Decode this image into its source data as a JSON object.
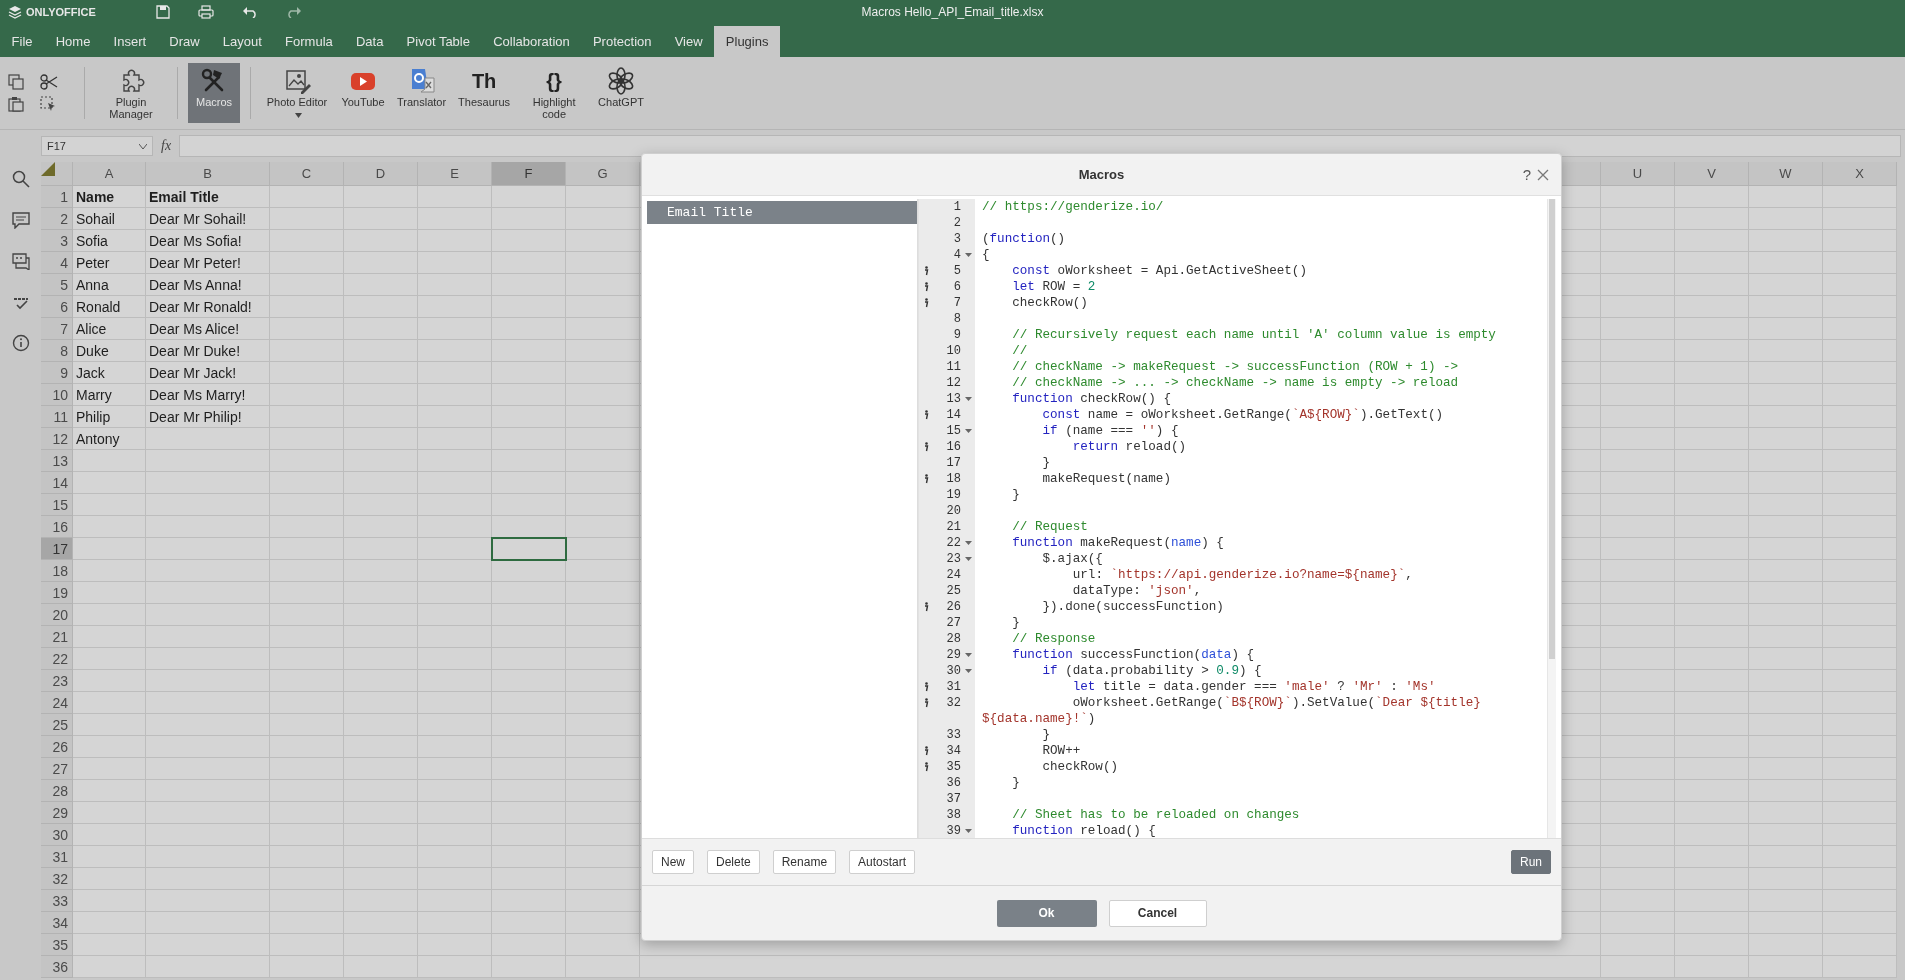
{
  "title_bar": {
    "logo": "ONLYOFFICE",
    "title": "Macros Hello_API_Email_title.xlsx"
  },
  "tabs": [
    {
      "label": "File",
      "selected": false
    },
    {
      "label": "Home",
      "selected": false
    },
    {
      "label": "Insert",
      "selected": false
    },
    {
      "label": "Draw",
      "selected": false
    },
    {
      "label": "Layout",
      "selected": false
    },
    {
      "label": "Formula",
      "selected": false
    },
    {
      "label": "Data",
      "selected": false
    },
    {
      "label": "Pivot Table",
      "selected": false
    },
    {
      "label": "Collaboration",
      "selected": false
    },
    {
      "label": "Protection",
      "selected": false
    },
    {
      "label": "View",
      "selected": false
    },
    {
      "label": "Plugins",
      "selected": true
    }
  ],
  "toolbar": [
    {
      "kind": "plugins",
      "label": "Plugin Manager",
      "selected": false
    },
    {
      "kind": "macros",
      "label": "Macros",
      "selected": true
    },
    {
      "kind": "photo",
      "label": "Photo Editor",
      "selected": false,
      "dropdown": true
    },
    {
      "kind": "youtube",
      "label": "YouTube",
      "selected": false
    },
    {
      "kind": "translator",
      "label": "Translator",
      "selected": false
    },
    {
      "kind": "glyph",
      "glyph": "Th",
      "label": "Thesaurus",
      "selected": false
    },
    {
      "kind": "glyph",
      "glyph": "{}",
      "label": "Highlight code",
      "selected": false
    },
    {
      "kind": "chatgpt",
      "label": "ChatGPT",
      "selected": false
    }
  ],
  "formula_bar": {
    "cell_ref": "F17",
    "function_label": "fx"
  },
  "sheet": {
    "columns_left": [
      {
        "label": "A",
        "selected": false
      },
      {
        "label": "B",
        "selected": false
      },
      {
        "label": "C",
        "selected": false
      },
      {
        "label": "D",
        "selected": false
      },
      {
        "label": "E",
        "selected": false
      },
      {
        "label": "F",
        "selected": true
      },
      {
        "label": "G",
        "selected": false
      }
    ],
    "columns_right": [
      {
        "label": "U",
        "selected": false
      },
      {
        "label": "V",
        "selected": false
      },
      {
        "label": "W",
        "selected": false
      },
      {
        "label": "X",
        "selected": false
      }
    ],
    "rows": [
      {
        "label": "1",
        "selected": false,
        "bold": true,
        "cells": [
          "Name",
          "Email Title"
        ]
      },
      {
        "label": "2",
        "selected": false,
        "bold": false,
        "cells": [
          "Sohail",
          "Dear Mr Sohail!"
        ]
      },
      {
        "label": "3",
        "selected": false,
        "bold": false,
        "cells": [
          "Sofia",
          "Dear Ms Sofia!"
        ]
      },
      {
        "label": "4",
        "selected": false,
        "bold": false,
        "cells": [
          "Peter",
          "Dear Mr Peter!"
        ]
      },
      {
        "label": "5",
        "selected": false,
        "bold": false,
        "cells": [
          "Anna",
          "Dear Ms Anna!"
        ]
      },
      {
        "label": "6",
        "selected": false,
        "bold": false,
        "cells": [
          "Ronald",
          "Dear Mr Ronald!"
        ]
      },
      {
        "label": "7",
        "selected": false,
        "bold": false,
        "cells": [
          "Alice",
          "Dear Ms Alice!"
        ]
      },
      {
        "label": "8",
        "selected": false,
        "bold": false,
        "cells": [
          "Duke",
          "Dear Mr Duke!"
        ]
      },
      {
        "label": "9",
        "selected": false,
        "bold": false,
        "cells": [
          "Jack",
          "Dear Mr Jack!"
        ]
      },
      {
        "label": "10",
        "selected": false,
        "bold": false,
        "cells": [
          "Marry",
          "Dear Ms Marry!"
        ]
      },
      {
        "label": "11",
        "selected": false,
        "bold": false,
        "cells": [
          "Philip",
          "Dear Mr Philip!"
        ]
      },
      {
        "label": "12",
        "selected": false,
        "bold": false,
        "cells": [
          "Antony"
        ]
      },
      {
        "label": "13",
        "selected": false
      },
      {
        "label": "14",
        "selected": false
      },
      {
        "label": "15",
        "selected": false
      },
      {
        "label": "16",
        "selected": false
      },
      {
        "label": "17",
        "selected": true
      },
      {
        "label": "18",
        "selected": false
      },
      {
        "label": "19",
        "selected": false
      },
      {
        "label": "20",
        "selected": false
      },
      {
        "label": "21",
        "selected": false
      },
      {
        "label": "22",
        "selected": false
      },
      {
        "label": "23",
        "selected": false
      },
      {
        "label": "24",
        "selected": false
      },
      {
        "label": "25",
        "selected": false
      },
      {
        "label": "26",
        "selected": false
      },
      {
        "label": "27",
        "selected": false
      },
      {
        "label": "28",
        "selected": false
      },
      {
        "label": "29",
        "selected": false
      },
      {
        "label": "30",
        "selected": false
      },
      {
        "label": "31",
        "selected": false
      },
      {
        "label": "32",
        "selected": false
      },
      {
        "label": "33",
        "selected": false
      },
      {
        "label": "34",
        "selected": false
      },
      {
        "label": "35",
        "selected": false
      },
      {
        "label": "36",
        "selected": false
      }
    ]
  },
  "dialog": {
    "title": "Macros",
    "help": "?",
    "macros": [
      {
        "name": "Email Title",
        "selected": true
      }
    ],
    "code_lines": [
      {
        "number": "1",
        "info": false,
        "fold": false,
        "tokens": [
          {
            "kind": "comment",
            "text": "// https://genderize.io/"
          }
        ]
      },
      {
        "number": "2",
        "info": false,
        "fold": false
      },
      {
        "number": "3",
        "info": false,
        "fold": false,
        "tokens": [
          {
            "kind": "plain",
            "text": "("
          },
          {
            "kind": "keyword",
            "text": "function"
          },
          {
            "kind": "plain",
            "text": "()"
          }
        ]
      },
      {
        "number": "4",
        "info": false,
        "fold": true,
        "tokens": [
          {
            "kind": "plain",
            "text": "{"
          }
        ]
      },
      {
        "number": "5",
        "info": true,
        "fold": false,
        "tokens": [
          {
            "kind": "keyword",
            "text": "    const"
          },
          {
            "kind": "plain",
            "text": " oWorksheet = Api.GetActiveSheet()"
          }
        ]
      },
      {
        "number": "6",
        "info": true,
        "fold": false,
        "tokens": [
          {
            "kind": "keyword",
            "text": "    let"
          },
          {
            "kind": "plain",
            "text": " ROW = "
          },
          {
            "kind": "number",
            "text": "2"
          }
        ]
      },
      {
        "number": "7",
        "info": true,
        "fold": false,
        "tokens": [
          {
            "kind": "plain",
            "text": "    checkRow()"
          }
        ]
      },
      {
        "number": "8",
        "info": false,
        "fold": false
      },
      {
        "number": "9",
        "info": false,
        "fold": false,
        "tokens": [
          {
            "kind": "comment",
            "text": "    // Recursively request each name until 'A' column value is empty"
          }
        ]
      },
      {
        "number": "10",
        "info": false,
        "fold": false,
        "tokens": [
          {
            "kind": "comment",
            "text": "    //"
          }
        ]
      },
      {
        "number": "11",
        "info": false,
        "fold": false,
        "tokens": [
          {
            "kind": "comment",
            "text": "    // checkName -> makeRequest -> successFunction (ROW + 1) ->"
          }
        ]
      },
      {
        "number": "12",
        "info": false,
        "fold": false,
        "tokens": [
          {
            "kind": "comment",
            "text": "    // checkName -> ... -> checkName -> name is empty -> reload"
          }
        ]
      },
      {
        "number": "13",
        "info": false,
        "fold": true,
        "tokens": [
          {
            "kind": "keyword",
            "text": "    function"
          },
          {
            "kind": "plain",
            "text": " checkRow() {"
          }
        ]
      },
      {
        "number": "14",
        "info": true,
        "fold": false,
        "tokens": [
          {
            "kind": "keyword",
            "text": "        const"
          },
          {
            "kind": "plain",
            "text": " name = oWorksheet.GetRange("
          },
          {
            "kind": "string",
            "text": "`A${ROW}`"
          },
          {
            "kind": "plain",
            "text": ").GetText()"
          }
        ]
      },
      {
        "number": "15",
        "info": false,
        "fold": true,
        "tokens": [
          {
            "kind": "keyword",
            "text": "        if"
          },
          {
            "kind": "plain",
            "text": " (name === "
          },
          {
            "kind": "string",
            "text": "''"
          },
          {
            "kind": "plain",
            "text": ") {"
          }
        ]
      },
      {
        "number": "16",
        "info": true,
        "fold": false,
        "tokens": [
          {
            "kind": "keyword",
            "text": "            return"
          },
          {
            "kind": "plain",
            "text": " reload()"
          }
        ]
      },
      {
        "number": "17",
        "info": false,
        "fold": false,
        "tokens": [
          {
            "kind": "plain",
            "text": "        }"
          }
        ]
      },
      {
        "number": "18",
        "info": true,
        "fold": false,
        "tokens": [
          {
            "kind": "plain",
            "text": "        makeRequest(name)"
          }
        ]
      },
      {
        "number": "19",
        "info": false,
        "fold": false,
        "tokens": [
          {
            "kind": "plain",
            "text": "    }"
          }
        ]
      },
      {
        "number": "20",
        "info": false,
        "fold": false
      },
      {
        "number": "21",
        "info": false,
        "fold": false,
        "tokens": [
          {
            "kind": "comment",
            "text": "    // Request"
          }
        ]
      },
      {
        "number": "22",
        "info": false,
        "fold": true,
        "tokens": [
          {
            "kind": "keyword",
            "text": "    function"
          },
          {
            "kind": "plain",
            "text": " makeRequest("
          },
          {
            "kind": "param",
            "text": "name"
          },
          {
            "kind": "plain",
            "text": ") {"
          }
        ]
      },
      {
        "number": "23",
        "info": false,
        "fold": true,
        "tokens": [
          {
            "kind": "plain",
            "text": "        $.ajax({"
          }
        ]
      },
      {
        "number": "24",
        "info": false,
        "fold": false,
        "tokens": [
          {
            "kind": "plain",
            "text": "            url: "
          },
          {
            "kind": "string",
            "text": "`https://api.genderize.io?name=${name}`"
          },
          {
            "kind": "plain",
            "text": ","
          }
        ]
      },
      {
        "number": "25",
        "info": false,
        "fold": false,
        "tokens": [
          {
            "kind": "plain",
            "text": "            dataType: "
          },
          {
            "kind": "string",
            "text": "'json'"
          },
          {
            "kind": "plain",
            "text": ","
          }
        ]
      },
      {
        "number": "26",
        "info": true,
        "fold": false,
        "tokens": [
          {
            "kind": "plain",
            "text": "        }).done(successFunction)"
          }
        ]
      },
      {
        "number": "27",
        "info": false,
        "fold": false,
        "tokens": [
          {
            "kind": "plain",
            "text": "    }"
          }
        ]
      },
      {
        "number": "28",
        "info": false,
        "fold": false,
        "tokens": [
          {
            "kind": "comment",
            "text": "    // Response"
          }
        ]
      },
      {
        "number": "29",
        "info": false,
        "fold": true,
        "tokens": [
          {
            "kind": "keyword",
            "text": "    function"
          },
          {
            "kind": "plain",
            "text": " successFunction("
          },
          {
            "kind": "param",
            "text": "data"
          },
          {
            "kind": "plain",
            "text": ") {"
          }
        ]
      },
      {
        "number": "30",
        "info": false,
        "fold": true,
        "tokens": [
          {
            "kind": "keyword",
            "text": "        if"
          },
          {
            "kind": "plain",
            "text": " (data.probability > "
          },
          {
            "kind": "number",
            "text": "0.9"
          },
          {
            "kind": "plain",
            "text": ") {"
          }
        ]
      },
      {
        "number": "31",
        "info": true,
        "fold": false,
        "tokens": [
          {
            "kind": "keyword",
            "text": "            let"
          },
          {
            "kind": "plain",
            "text": " title = data.gender === "
          },
          {
            "kind": "string",
            "text": "'male'"
          },
          {
            "kind": "plain",
            "text": " ? "
          },
          {
            "kind": "string",
            "text": "'Mr'"
          },
          {
            "kind": "plain",
            "text": " : "
          },
          {
            "kind": "string",
            "text": "'Ms'"
          }
        ]
      },
      {
        "number": "32",
        "info": true,
        "fold": false,
        "tokens": [
          {
            "kind": "plain",
            "text": "            oWorksheet.GetRange("
          },
          {
            "kind": "string",
            "text": "`B${ROW}`"
          },
          {
            "kind": "plain",
            "text": ").SetValue("
          },
          {
            "kind": "string",
            "text": "`Dear ${title} ${data.name}!`"
          },
          {
            "kind": "plain",
            "text": ")"
          }
        ]
      },
      {
        "number": "33",
        "info": false,
        "fold": false,
        "tokens": [
          {
            "kind": "plain",
            "text": "        }"
          }
        ]
      },
      {
        "number": "34",
        "info": true,
        "fold": false,
        "tokens": [
          {
            "kind": "plain",
            "text": "        ROW++"
          }
        ]
      },
      {
        "number": "35",
        "info": true,
        "fold": false,
        "tokens": [
          {
            "kind": "plain",
            "text": "        checkRow()"
          }
        ]
      },
      {
        "number": "36",
        "info": false,
        "fold": false,
        "tokens": [
          {
            "kind": "plain",
            "text": "    }"
          }
        ]
      },
      {
        "number": "37",
        "info": false,
        "fold": false
      },
      {
        "number": "38",
        "info": false,
        "fold": false,
        "tokens": [
          {
            "kind": "comment",
            "text": "    // Sheet has to be reloaded on changes"
          }
        ]
      },
      {
        "number": "39",
        "info": false,
        "fold": true,
        "tokens": [
          {
            "kind": "keyword",
            "text": "    function"
          },
          {
            "kind": "plain",
            "text": " reload() {"
          }
        ]
      }
    ],
    "macro_buttons": [
      "New",
      "Delete",
      "Rename",
      "Autostart"
    ],
    "run_button": "Run",
    "ok_button": "Ok",
    "cancel_button": "Cancel"
  }
}
